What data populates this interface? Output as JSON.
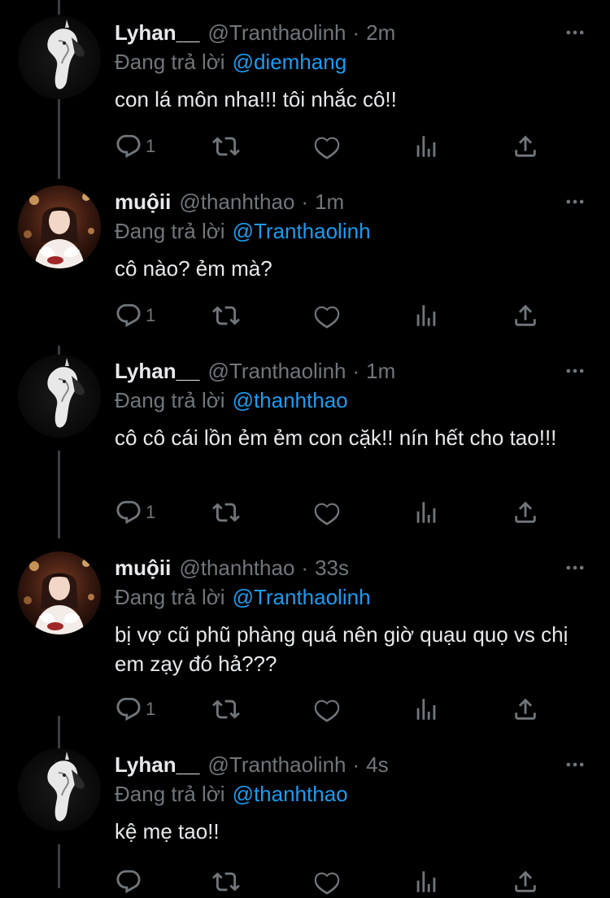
{
  "tweets": [
    {
      "name": "Lyhan__",
      "handle": "@Tranthaolinh",
      "dot": "·",
      "time": "2m",
      "reply_prefix": "Đang trả lời",
      "reply_to": "@diemhang",
      "text": "con lá môn nha!!! tôi nhắc cô!!",
      "reply_count": "1",
      "avatar_icon": "horse-head-avatar"
    },
    {
      "name": "muộii",
      "handle": "@thanhthao",
      "dot": "·",
      "time": "1m",
      "reply_prefix": "Đang trả lời",
      "reply_to": "@Tranthaolinh",
      "text": "cô nào? ẻm mà?",
      "reply_count": "1",
      "avatar_icon": "girl-photo-avatar"
    },
    {
      "name": "Lyhan__",
      "handle": "@Tranthaolinh",
      "dot": "·",
      "time": "1m",
      "reply_prefix": "Đang trả lời",
      "reply_to": "@thanhthao",
      "text": "cô cô cái lồn ẻm ẻm con cặk!! nín hết cho tao!!!",
      "reply_count": "1",
      "avatar_icon": "horse-head-avatar"
    },
    {
      "name": "muộii",
      "handle": "@thanhthao",
      "dot": "·",
      "time": "33s",
      "reply_prefix": "Đang trả lời",
      "reply_to": "@Tranthaolinh",
      "text": "bị vợ cũ phũ phàng quá nên giờ quạu quọ vs chị em zạy đó hả???",
      "reply_count": "1",
      "avatar_icon": "girl-photo-avatar"
    },
    {
      "name": "Lyhan__",
      "handle": "@Tranthaolinh",
      "dot": "·",
      "time": "4s",
      "reply_prefix": "Đang trả lời",
      "reply_to": "@thanhthao",
      "text": "kệ mẹ tao!!",
      "reply_count": "",
      "avatar_icon": "horse-head-avatar"
    }
  ],
  "icons": [
    "reply-icon",
    "retweet-icon",
    "like-icon",
    "views-icon",
    "share-icon",
    "more-icon"
  ],
  "colors": {
    "background": "#000000",
    "text": "#e7e9ea",
    "muted": "#71767b",
    "link": "#1d9bf0",
    "thread_line": "#3a3d41"
  }
}
